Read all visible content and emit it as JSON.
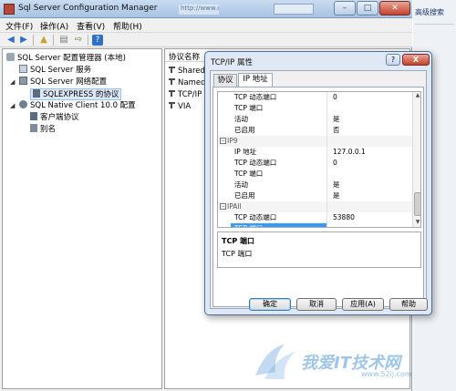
{
  "window": {
    "title": "Sql Server Configuration Manager",
    "ghost_find": "高级▼",
    "ghost_tab": "http://www.c"
  },
  "menu": [
    "文件(F)",
    "操作(A)",
    "查看(V)",
    "帮助(H)"
  ],
  "toolbar_icons": [
    "back-arrow-icon",
    "forward-arrow-icon",
    "up-folder-icon",
    "properties-icon",
    "export-icon",
    "help-icon"
  ],
  "tree": {
    "root": "SQL Server 配置管理器 (本地)",
    "items": [
      "SQL Server 服务",
      "SQL Server 网络配置",
      "SQLEXPRESS 的协议",
      "SQL Native Client 10.0 配置",
      "客户端协议",
      "别名"
    ]
  },
  "list": {
    "header": "协议名称",
    "rows": [
      "Shared",
      "Named",
      "TCP/IP",
      "VIA"
    ]
  },
  "side_strip": {
    "text": "高级搜索"
  },
  "dialog": {
    "title": "TCP/IP 属性",
    "help_label": "?",
    "close_label": "X",
    "tabs": [
      "协议",
      "IP 地址"
    ],
    "active_tab": 1,
    "rows": [
      {
        "kind": "prop",
        "key": "TCP 动态端口",
        "value": "0"
      },
      {
        "kind": "prop",
        "key": "TCP 端口",
        "value": ""
      },
      {
        "kind": "prop",
        "key": "活动",
        "value": "是"
      },
      {
        "kind": "prop",
        "key": "已启用",
        "value": "否"
      },
      {
        "kind": "cat",
        "key": "IP9",
        "value": ""
      },
      {
        "kind": "prop",
        "key": "IP 地址",
        "value": "127.0.0.1"
      },
      {
        "kind": "prop",
        "key": "TCP 动态端口",
        "value": "0"
      },
      {
        "kind": "prop",
        "key": "TCP 端口",
        "value": ""
      },
      {
        "kind": "prop",
        "key": "活动",
        "value": "是"
      },
      {
        "kind": "prop",
        "key": "已启用",
        "value": "是"
      },
      {
        "kind": "cat",
        "key": "IPAll",
        "value": ""
      },
      {
        "kind": "prop",
        "key": "TCP 动态端口",
        "value": "53880"
      },
      {
        "kind": "selected",
        "key": "TCP 端口",
        "value": ""
      }
    ],
    "description": {
      "heading": "TCP 端口",
      "text": "TCP 端口"
    },
    "buttons": {
      "ok": "确定",
      "cancel": "取消",
      "apply": "应用(A)",
      "help": "帮助"
    }
  },
  "watermark": {
    "text": "我爱IT技术网",
    "url": "www.52ij.com"
  }
}
